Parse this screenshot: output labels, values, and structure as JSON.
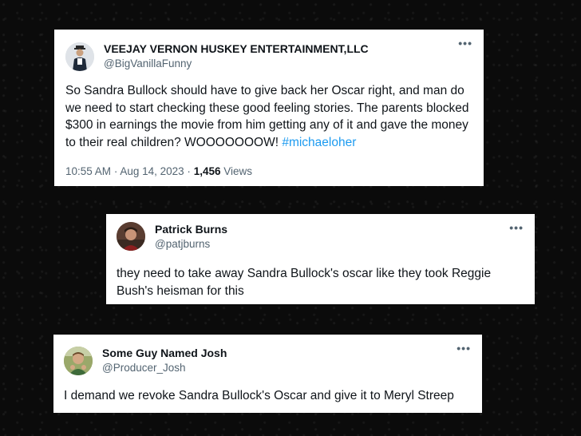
{
  "tweets": [
    {
      "name": "VEEJAY VERNON HUSKEY ENTERTAINMENT,LLC",
      "handle": "@BigVanillaFunny",
      "text_main": "So Sandra Bullock should have to give back her Oscar right, and man do we need to start checking these good feeling stories. The parents blocked $300 in earnings the movie from him getting any of it and gave the money to their real children? WOOOOOOOW! ",
      "hashtag": "#michaeloher",
      "time": "10:55 AM",
      "date": "Aug 14, 2023",
      "views_count": "1,456",
      "views_label": "Views"
    },
    {
      "name": "Patrick Burns",
      "handle": "@patjburns",
      "text_main": "they need to take away Sandra Bullock's oscar like they took Reggie Bush's heisman for this"
    },
    {
      "name": "Some Guy Named Josh",
      "handle": "@Producer_Josh",
      "text_main": "I demand we revoke Sandra Bullock's Oscar and give it to Meryl Streep"
    }
  ],
  "separators": {
    "dot": "·"
  },
  "icons": {
    "more": "more-options-icon"
  },
  "colors": {
    "link": "#1d9bf0",
    "secondary": "#536471",
    "background": "#0b0b0b"
  }
}
